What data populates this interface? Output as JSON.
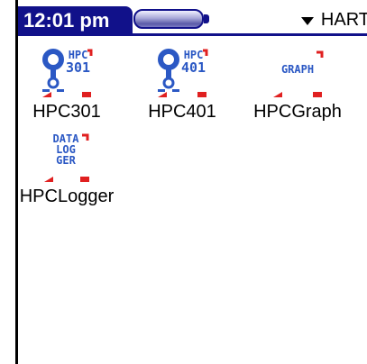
{
  "status_bar": {
    "time": "12:01 pm",
    "category": "HART"
  },
  "apps": [
    {
      "label": "HPC301",
      "icon": "hpc301-icon",
      "icon_text": [
        "HPC",
        "301"
      ]
    },
    {
      "label": "HPC401",
      "icon": "hpc401-icon",
      "icon_text": [
        "HPC",
        "401"
      ]
    },
    {
      "label": "HPCGraph",
      "icon": "graph-icon",
      "icon_text": [
        "GRAPH"
      ]
    },
    {
      "label": "HPCLogger",
      "icon": "logger-icon",
      "icon_text": [
        "DATA",
        "LOG",
        "GER"
      ]
    }
  ],
  "colors": {
    "title_bar": "#11118a",
    "icon_blue": "#2b58c4",
    "icon_red": "#e02020"
  }
}
